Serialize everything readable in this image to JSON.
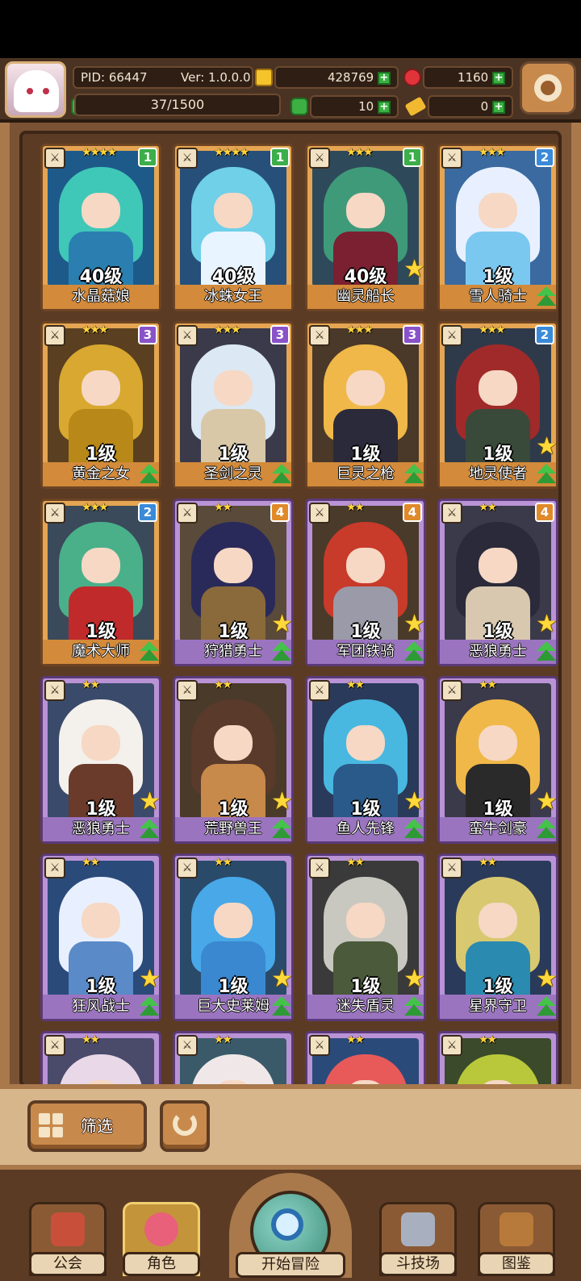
{
  "header": {
    "pid": "PID: 66447",
    "version": "Ver: 1.0.0.0",
    "gold": "428769",
    "gems": "1160",
    "clover": "10",
    "keys": "0",
    "xp": "37/1500"
  },
  "cards": [
    {
      "name": "水晶菇娘",
      "level": "40级",
      "stars": "★★★★",
      "badge": "1",
      "frame": "gold",
      "hair": "#3fc7b8",
      "body": "#2a7fb0",
      "bg": "#1d5a8a",
      "star": false,
      "up": false
    },
    {
      "name": "冰蛛女王",
      "level": "40级",
      "stars": "★★★★",
      "badge": "1",
      "frame": "gold",
      "hair": "#6fd0e8",
      "body": "#e8f4ff",
      "bg": "#26507a",
      "star": false,
      "up": false
    },
    {
      "name": "幽灵船长",
      "level": "40级",
      "stars": "★★★",
      "badge": "1",
      "frame": "gold",
      "hair": "#3f9a7a",
      "body": "#7a2030",
      "bg": "#2e4a5a",
      "star": true,
      "up": false
    },
    {
      "name": "雪人骑士",
      "level": "1级",
      "stars": "★★★",
      "badge": "2",
      "frame": "gold",
      "hair": "#e8f0ff",
      "body": "#7ac8f0",
      "bg": "#3a6aa0",
      "star": false,
      "up": true
    },
    {
      "name": "黄金之女",
      "level": "1级",
      "stars": "★★★",
      "badge": "3",
      "frame": "gold",
      "hair": "#d8a830",
      "body": "#b88818",
      "bg": "#5a4020",
      "star": false,
      "up": true
    },
    {
      "name": "圣剑之灵",
      "level": "1级",
      "stars": "★★★",
      "badge": "3",
      "frame": "gold",
      "hair": "#dce8f4",
      "body": "#d8c8a8",
      "bg": "#3a3a4a",
      "star": false,
      "up": true
    },
    {
      "name": "巨灵之枪",
      "level": "1级",
      "stars": "★★★",
      "badge": "3",
      "frame": "gold",
      "hair": "#f0b848",
      "body": "#2a2a3a",
      "bg": "#4a3828",
      "star": false,
      "up": true
    },
    {
      "name": "地灵使者",
      "level": "1级",
      "stars": "★★★",
      "badge": "2",
      "frame": "gold",
      "hair": "#a02a2a",
      "body": "#3a4a3a",
      "bg": "#2e3a4a",
      "star": true,
      "up": true
    },
    {
      "name": "魔术大师",
      "level": "1级",
      "stars": "★★★",
      "badge": "2",
      "frame": "gold",
      "hair": "#4ab08a",
      "body": "#c02a2a",
      "bg": "#3a4a5a",
      "star": false,
      "up": true
    },
    {
      "name": "狩猎勇士",
      "level": "1级",
      "stars": "★★",
      "badge": "4",
      "frame": "purple",
      "hair": "#2a2a5a",
      "body": "#8a6a3a",
      "bg": "#5a4a3a",
      "star": true,
      "up": true
    },
    {
      "name": "军团铁骑",
      "level": "1级",
      "stars": "★★",
      "badge": "4",
      "frame": "purple",
      "hair": "#c83a2a",
      "body": "#9a9aa8",
      "bg": "#4a3a2a",
      "star": true,
      "up": true
    },
    {
      "name": "恶狼勇士",
      "level": "1级",
      "stars": "★★",
      "badge": "4",
      "frame": "purple",
      "hair": "#2a2a3a",
      "body": "#d8c8b0",
      "bg": "#3a3a4a",
      "star": true,
      "up": true
    },
    {
      "name": "恶狼勇士",
      "level": "1级",
      "stars": "★★",
      "badge": "",
      "frame": "purple",
      "hair": "#f4f0ec",
      "body": "#6a3a2a",
      "bg": "#3a4a6a",
      "star": true,
      "up": true
    },
    {
      "name": "荒野兽王",
      "level": "1级",
      "stars": "★★",
      "badge": "",
      "frame": "purple",
      "hair": "#5a3a2a",
      "body": "#c88a4a",
      "bg": "#4a3a2a",
      "star": true,
      "up": true
    },
    {
      "name": "鱼人先锋",
      "level": "1级",
      "stars": "★★",
      "badge": "",
      "frame": "purple",
      "hair": "#48b8e0",
      "body": "#2a5a8a",
      "bg": "#2a3a5a",
      "star": true,
      "up": true
    },
    {
      "name": "蛮牛剑豪",
      "level": "1级",
      "stars": "★★",
      "badge": "",
      "frame": "purple",
      "hair": "#f0b848",
      "body": "#2a2a2a",
      "bg": "#3a3a4a",
      "star": true,
      "up": true
    },
    {
      "name": "狂风战士",
      "level": "1级",
      "stars": "★★",
      "badge": "",
      "frame": "purple",
      "hair": "#e8f0ff",
      "body": "#5a8ac8",
      "bg": "#2a4a7a",
      "star": true,
      "up": true
    },
    {
      "name": "巨大史莱姆",
      "level": "1级",
      "stars": "★★",
      "badge": "",
      "frame": "purple",
      "hair": "#48a8e8",
      "body": "#3a88d0",
      "bg": "#2a4a6a",
      "star": true,
      "up": true
    },
    {
      "name": "迷失盾灵",
      "level": "1级",
      "stars": "★★",
      "badge": "",
      "frame": "purple",
      "hair": "#c8c8c0",
      "body": "#4a5a3a",
      "bg": "#3a3a3a",
      "star": true,
      "up": true
    },
    {
      "name": "星界守卫",
      "level": "1级",
      "stars": "★★",
      "badge": "",
      "frame": "purple",
      "hair": "#d8c870",
      "body": "#2a8ab0",
      "bg": "#2a3a5a",
      "star": true,
      "up": true
    },
    {
      "name": "",
      "level": "",
      "stars": "★★",
      "badge": "",
      "frame": "purple",
      "hair": "#e8d8e8",
      "body": "#4a4a6a",
      "bg": "#4a4a6a",
      "star": false,
      "up": false
    },
    {
      "name": "",
      "level": "",
      "stars": "★★",
      "badge": "",
      "frame": "purple",
      "hair": "#f0e8e8",
      "body": "#4a5a6a",
      "bg": "#3a5a6a",
      "star": false,
      "up": false
    },
    {
      "name": "",
      "level": "",
      "stars": "★★",
      "badge": "",
      "frame": "purple",
      "hair": "#e85a5a",
      "body": "#4a7ac8",
      "bg": "#2a4a7a",
      "star": false,
      "up": false
    },
    {
      "name": "",
      "level": "",
      "stars": "★★",
      "badge": "",
      "frame": "purple",
      "hair": "#b8c83a",
      "body": "#5a6a2a",
      "bg": "#3a4a2a",
      "star": false,
      "up": false
    }
  ],
  "controls": {
    "filter_label": "筛选"
  },
  "nav": {
    "guild": "公会",
    "role": "角色",
    "adventure": "开始冒险",
    "arena": "斗技场",
    "codex": "图鉴"
  }
}
